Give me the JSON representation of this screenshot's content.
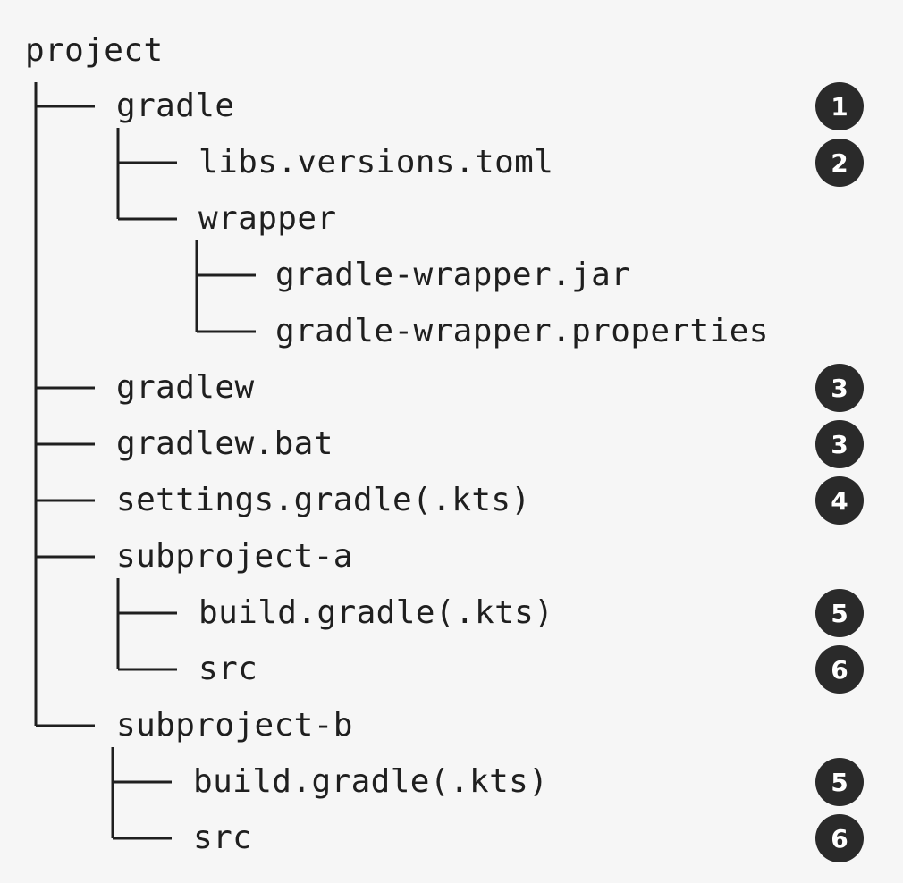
{
  "tree": {
    "root": "project",
    "entries": [
      {
        "name": "gradle",
        "depth": 1,
        "badge": "1"
      },
      {
        "name": "libs.versions.toml",
        "depth": 2,
        "badge": "2"
      },
      {
        "name": "wrapper",
        "depth": 2,
        "badge": ""
      },
      {
        "name": "gradle-wrapper.jar",
        "depth": 3,
        "badge": ""
      },
      {
        "name": "gradle-wrapper.properties",
        "depth": 3,
        "badge": ""
      },
      {
        "name": "gradlew",
        "depth": 1,
        "badge": "3"
      },
      {
        "name": "gradlew.bat",
        "depth": 1,
        "badge": "3"
      },
      {
        "name": "settings.gradle(.kts)",
        "depth": 1,
        "badge": "4"
      },
      {
        "name": "subproject-a",
        "depth": 1,
        "badge": ""
      },
      {
        "name": "build.gradle(.kts)",
        "depth": 2,
        "badge": "5"
      },
      {
        "name": "src",
        "depth": 2,
        "badge": "6"
      },
      {
        "name": "subproject-b",
        "depth": 1,
        "badge": ""
      },
      {
        "name": "build.gradle(.kts)",
        "depth": 2,
        "badge": "5"
      },
      {
        "name": "src",
        "depth": 2,
        "badge": "6"
      }
    ]
  },
  "colors": {
    "background": "#f6f6f6",
    "text": "#1f1f1f",
    "badge": "#2a2a2a",
    "badge_text": "#ffffff"
  }
}
